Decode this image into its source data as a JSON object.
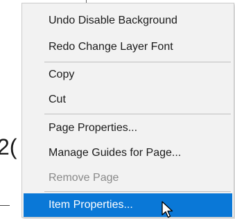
{
  "background": {
    "partial_text": "2("
  },
  "menu": {
    "items": [
      {
        "label": "Undo Disable Background",
        "enabled": true
      },
      {
        "label": "Redo Change Layer Font",
        "enabled": true
      },
      {
        "label": "Copy",
        "enabled": true
      },
      {
        "label": "Cut",
        "enabled": true
      },
      {
        "label": "Page Properties...",
        "enabled": true
      },
      {
        "label": "Manage Guides for Page...",
        "enabled": true
      },
      {
        "label": "Remove Page",
        "enabled": false
      },
      {
        "label": "Item Properties...",
        "enabled": true,
        "highlighted": true
      }
    ]
  },
  "colors": {
    "menu_background": "#f2f2f2",
    "highlight": "#0a78d7",
    "disabled_text": "#8a8a8a"
  },
  "cursor": {
    "icon": "arrow-pointer-icon"
  }
}
